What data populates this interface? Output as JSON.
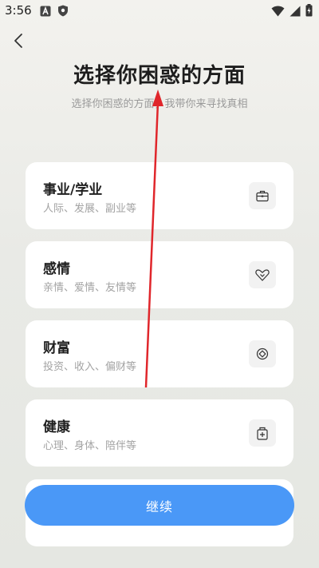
{
  "status_bar": {
    "time": "3:56",
    "left_icons": [
      "notification-a-icon",
      "shield-icon"
    ],
    "right_icons": [
      "wifi-icon",
      "signal-icon",
      "battery-icon"
    ]
  },
  "header": {
    "back_icon": "chevron-left-icon",
    "title": "选择你困惑的方面",
    "subtitle": "选择你困惑的方面，我带你来寻找真相"
  },
  "categories": [
    {
      "title": "事业/学业",
      "desc": "人际、发展、副业等",
      "icon": "briefcase-icon"
    },
    {
      "title": "感情",
      "desc": "亲情、爱情、友情等",
      "icon": "heart-icon"
    },
    {
      "title": "财富",
      "desc": "投资、收入、偏财等",
      "icon": "coin-icon"
    },
    {
      "title": "健康",
      "desc": "心理、身体、陪伴等",
      "icon": "medical-kit-icon"
    }
  ],
  "continue_button": {
    "label": "继续"
  },
  "colors": {
    "accent": "#4a98f7",
    "annotation_arrow": "#e0262b",
    "background": "#ecece8",
    "card": "#ffffff",
    "icon_bg": "#f2f2f2"
  }
}
